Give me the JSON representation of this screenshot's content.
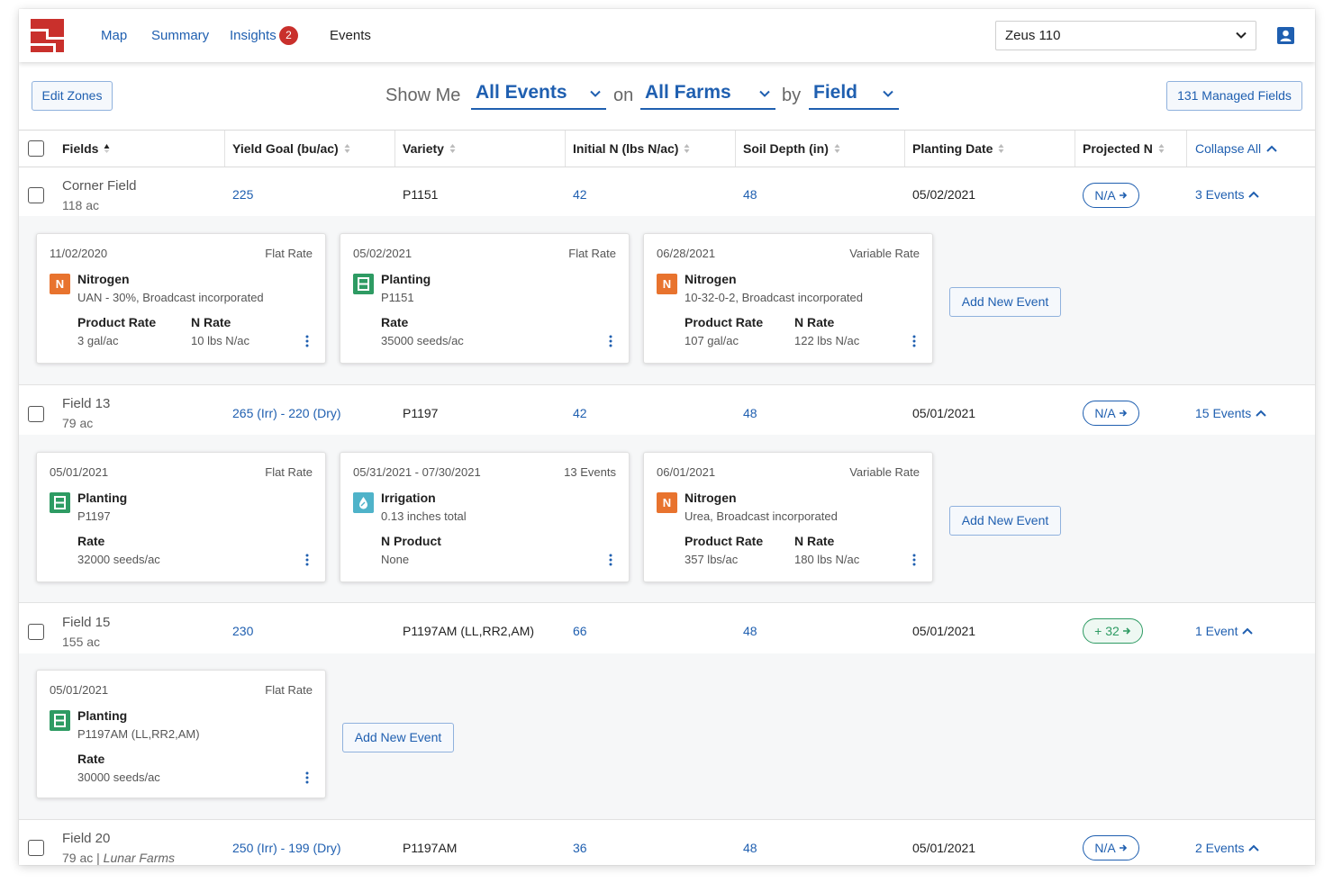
{
  "nav": {
    "links": [
      "Map",
      "Summary",
      "Insights",
      "Events"
    ],
    "insights_badge": "2",
    "device": "Zeus 110"
  },
  "toolbar": {
    "edit_zones": "Edit Zones",
    "show_me": "Show Me",
    "events_filter": "All Events",
    "on": "on",
    "farms_filter": "All Farms",
    "by": "by",
    "group_filter": "Field",
    "managed_fields": "131 Managed Fields"
  },
  "table": {
    "headers": [
      "Fields",
      "Yield Goal (bu/ac)",
      "Variety",
      "Initial N (lbs N/ac)",
      "Soil Depth (in)",
      "Planting Date",
      "Projected N"
    ],
    "collapse_all": "Collapse All",
    "add_new_event": "Add New Event",
    "rows": [
      {
        "name": "Corner Field",
        "area": "118 ac",
        "farm": "",
        "yield_goal": "225",
        "variety": "P1151",
        "initial_n": "42",
        "soil_depth": "48",
        "planting_date": "05/02/2021",
        "projected_n": "N/A",
        "events": "3 Events",
        "cards": [
          {
            "date": "11/02/2020",
            "rate_type": "Flat Rate",
            "icon": "N",
            "title": "Nitrogen",
            "sub": "UAN - 30%, Broadcast incorporated",
            "label1": "Product Rate",
            "value1": "3 gal/ac",
            "label2": "N Rate",
            "value2": "10 lbs N/ac"
          },
          {
            "date": "05/02/2021",
            "rate_type": "Flat Rate",
            "icon": "P",
            "title": "Planting",
            "sub": "P1151",
            "label1": "Rate",
            "value1": "35000 seeds/ac",
            "label2": "",
            "value2": ""
          },
          {
            "date": "06/28/2021",
            "rate_type": "Variable Rate",
            "icon": "N",
            "title": "Nitrogen",
            "sub": "10-32-0-2, Broadcast incorporated",
            "label1": "Product Rate",
            "value1": "107 gal/ac",
            "label2": "N Rate",
            "value2": "122 lbs N/ac"
          }
        ]
      },
      {
        "name": "Field 13",
        "area": "79 ac",
        "farm": "",
        "yield_goal": "265 (Irr) - 220 (Dry)",
        "variety": "P1197",
        "initial_n": "42",
        "soil_depth": "48",
        "planting_date": "05/01/2021",
        "projected_n": "N/A",
        "events": "15 Events",
        "cards": [
          {
            "date": "05/01/2021",
            "rate_type": "Flat Rate",
            "icon": "P",
            "title": "Planting",
            "sub": "P1197",
            "label1": "Rate",
            "value1": "32000 seeds/ac",
            "label2": "",
            "value2": ""
          },
          {
            "date": "05/31/2021 - 07/30/2021",
            "rate_type": "13 Events",
            "icon": "I",
            "title": "Irrigation",
            "sub": "0.13 inches total",
            "label1": "N Product",
            "value1": "None",
            "label2": "",
            "value2": ""
          },
          {
            "date": "06/01/2021",
            "rate_type": "Variable Rate",
            "icon": "N",
            "title": "Nitrogen",
            "sub": "Urea, Broadcast incorporated",
            "label1": "Product Rate",
            "value1": "357 lbs/ac",
            "label2": "N Rate",
            "value2": "180 lbs N/ac"
          }
        ]
      },
      {
        "name": "Field 15",
        "area": "155 ac",
        "farm": "",
        "yield_goal": "230",
        "variety": "P1197AM (LL,RR2,AM)",
        "initial_n": "66",
        "soil_depth": "48",
        "planting_date": "05/01/2021",
        "projected_n": "+ 32",
        "events": "1 Event",
        "cards": [
          {
            "date": "05/01/2021",
            "rate_type": "Flat Rate",
            "icon": "P",
            "title": "Planting",
            "sub": "P1197AM (LL,RR2,AM)",
            "label1": "Rate",
            "value1": "30000 seeds/ac",
            "label2": "",
            "value2": ""
          }
        ]
      },
      {
        "name": "Field 20",
        "area": "79 ac",
        "farm": "Lunar Farms",
        "yield_goal": "250 (Irr) - 199 (Dry)",
        "variety": "P1197AM",
        "initial_n": "36",
        "soil_depth": "48",
        "planting_date": "05/01/2021",
        "projected_n": "N/A",
        "events": "2 Events",
        "cards": []
      }
    ]
  },
  "colors": {
    "accent": "#1f5fb0",
    "nitrogen": "#e8732e",
    "planting": "#2e9b63",
    "irrigation": "#4fb3c9",
    "badge": "#c9302c",
    "logo": "#c9302c"
  },
  "icons": [
    "logo-icon",
    "chevron-down-icon",
    "user-icon",
    "sort-icon",
    "chevron-up-icon",
    "arrow-right-icon",
    "kebab-icon",
    "planting-icon",
    "irrigation-icon"
  ]
}
